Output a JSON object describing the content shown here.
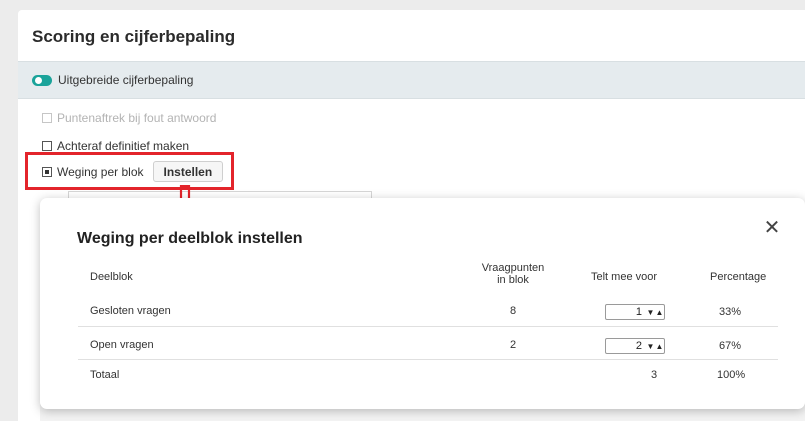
{
  "page": {
    "title": "Scoring en cijferbepaling",
    "toggle_label": "Uitgebreide cijferbepaling",
    "options": [
      {
        "label": "Puntenaftrek bij fout antwoord",
        "checked": false,
        "disabled": true
      },
      {
        "label": "Achteraf definitief maken",
        "checked": false,
        "disabled": false
      },
      {
        "label": "Weging per blok",
        "checked": true,
        "disabled": false
      }
    ],
    "instellen_label": "Instellen"
  },
  "modal": {
    "title": "Weging per deelblok instellen",
    "close_icon": "close-icon",
    "headers": {
      "deelblok": "Deelblok",
      "vraagpunten_line1": "Vraagpunten",
      "vraagpunten_line2": "in blok",
      "telt": "Telt mee voor",
      "percentage": "Percentage"
    },
    "rows": [
      {
        "name": "Gesloten vragen",
        "points": "8",
        "weight": "1",
        "percentage": "33%"
      },
      {
        "name": "Open vragen",
        "points": "2",
        "weight": "2",
        "percentage": "67%"
      }
    ],
    "total": {
      "label": "Totaal",
      "weight": "3",
      "percentage": "100%"
    },
    "stepper_down": "▼",
    "stepper_up": "▲"
  },
  "colors": {
    "accent": "#1aa39a",
    "highlight": "#e3242b"
  }
}
